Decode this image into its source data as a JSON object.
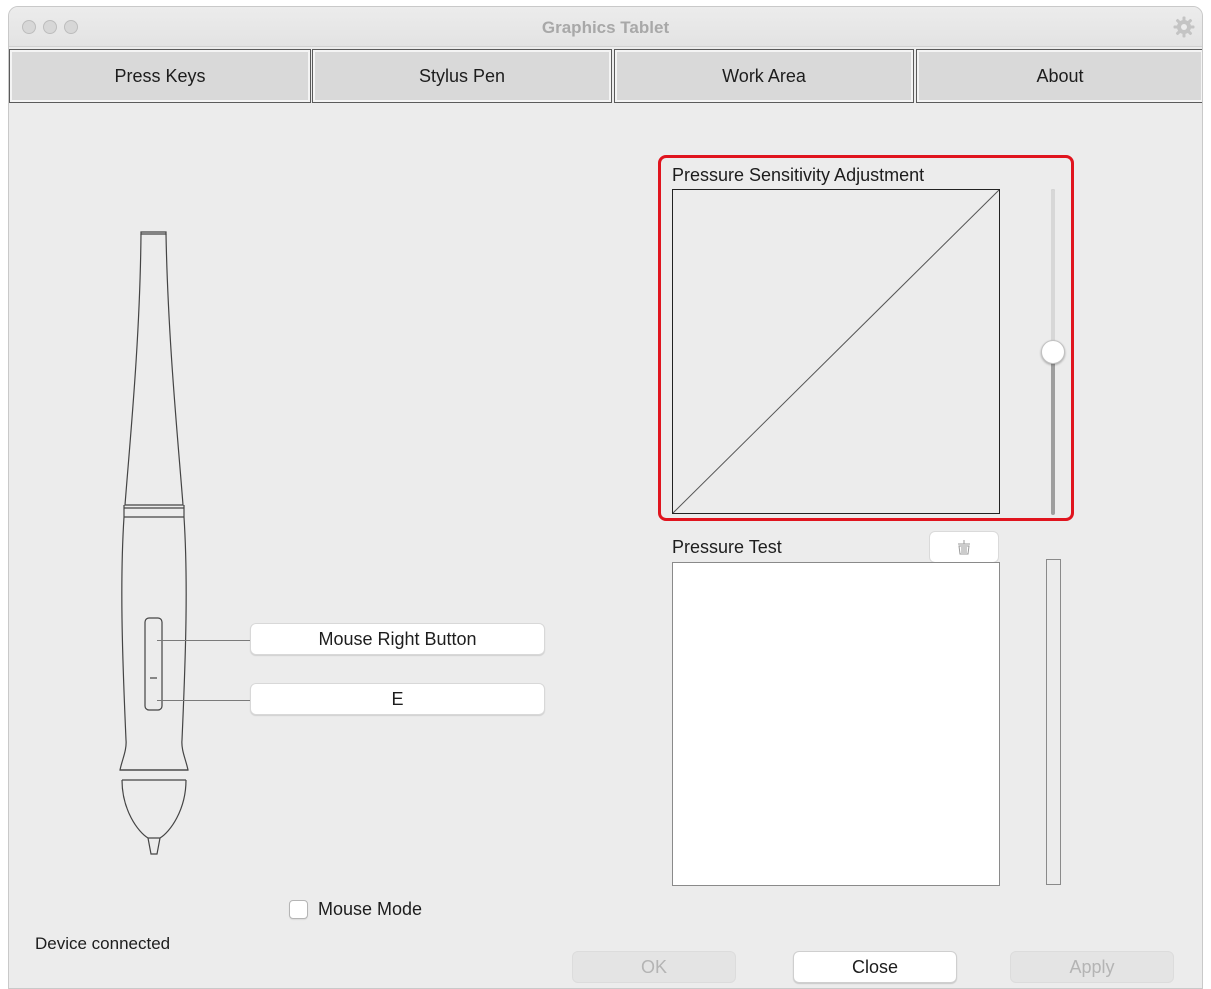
{
  "window": {
    "title": "Graphics Tablet"
  },
  "tabs": [
    {
      "label": "Press Keys"
    },
    {
      "label": "Stylus Pen"
    },
    {
      "label": "Work Area"
    },
    {
      "label": "About"
    }
  ],
  "pen": {
    "upper_button": "Mouse Right Button",
    "lower_button": "E"
  },
  "mouse_mode": {
    "label": "Mouse Mode",
    "checked": false
  },
  "status": {
    "text": "Device connected"
  },
  "pressure_sensitivity": {
    "label": "Pressure Sensitivity Adjustment",
    "slider_level": 0.5,
    "highlight_color": "#e0141e"
  },
  "pressure_test": {
    "label": "Pressure Test",
    "clear_icon": "basket-icon"
  },
  "buttons": {
    "ok": "OK",
    "close": "Close",
    "apply": "Apply"
  },
  "icons": {
    "settings": "gear-icon"
  }
}
